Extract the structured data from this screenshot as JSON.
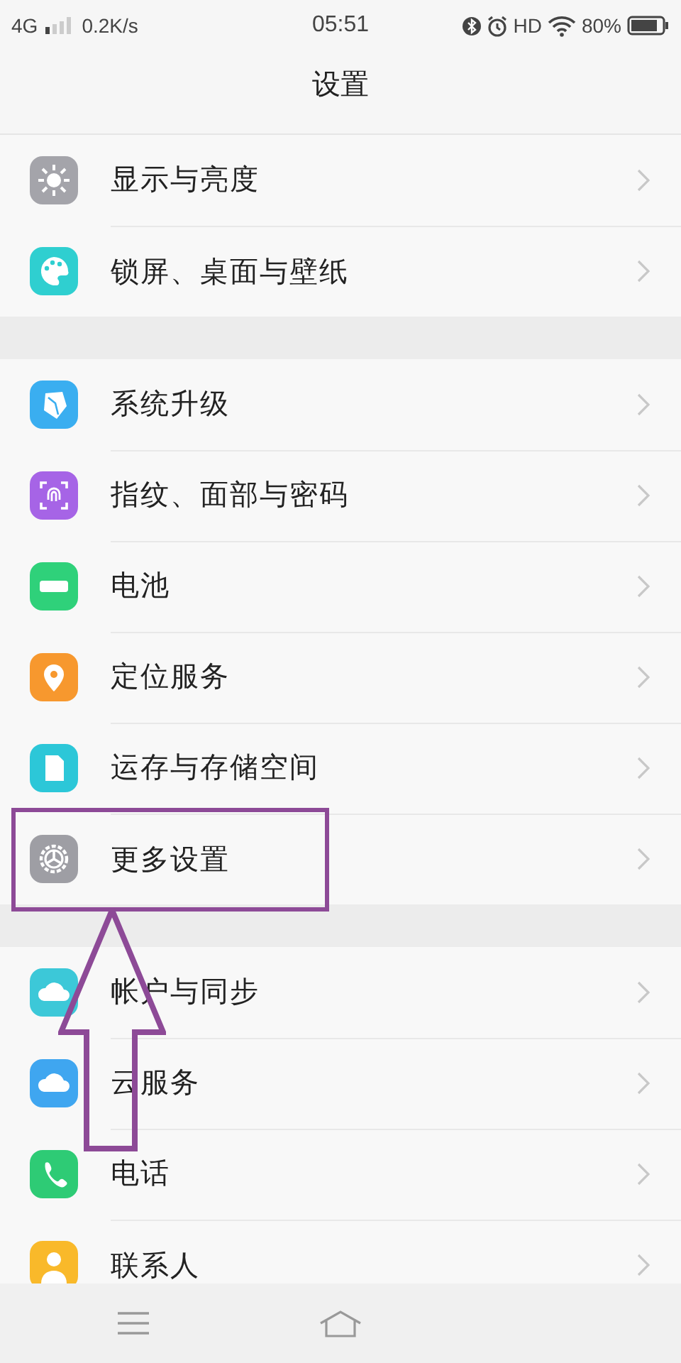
{
  "status_bar": {
    "network": "4G",
    "speed": "0.2K/s",
    "time": "05:51",
    "hd": "HD",
    "battery": "80%"
  },
  "title": "设置",
  "groups": [
    {
      "items": [
        {
          "label": "显示与亮度",
          "color": "#a4a4aa",
          "highlighted": false
        },
        {
          "label": "锁屏、桌面与壁纸",
          "color": "#2fcfd0",
          "highlighted": false
        }
      ]
    },
    {
      "items": [
        {
          "label": "系统升级",
          "color": "#3aaef0",
          "highlighted": false
        },
        {
          "label": "指纹、面部与密码",
          "color": "#a664e6",
          "highlighted": false
        },
        {
          "label": "电池",
          "color": "#2fd17a",
          "highlighted": false
        },
        {
          "label": "定位服务",
          "color": "#f7982e",
          "highlighted": false
        },
        {
          "label": "运存与存储空间",
          "color": "#2cc7d8",
          "highlighted": false
        },
        {
          "label": "更多设置",
          "color": "#9e9ea4",
          "highlighted": true
        }
      ]
    },
    {
      "items": [
        {
          "label": "帐户与同步",
          "color": "#3cc8d8",
          "highlighted": false
        },
        {
          "label": "云服务",
          "color": "#3fa6f0",
          "highlighted": false
        },
        {
          "label": "电话",
          "color": "#2ecb75",
          "highlighted": false
        },
        {
          "label": "联系人",
          "color": "#f9b92a",
          "highlighted": false
        }
      ]
    }
  ]
}
